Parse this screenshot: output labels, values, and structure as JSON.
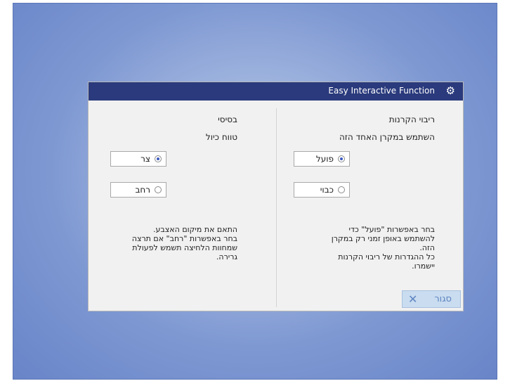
{
  "dialog": {
    "title": "Easy Interactive Function",
    "settings_icon": "gear-icon",
    "accent": "#2a3a7c"
  },
  "right_column": {
    "heading": "ריבוי הקרנות",
    "subheading": "השתמש במקרן האחד הזה",
    "options": [
      {
        "label": "פועל",
        "selected": true
      },
      {
        "label": "כבוי",
        "selected": false
      }
    ],
    "description": [
      "בחר באפשרות \"פועל\" כדי",
      "להשתמש באופן זמני רק במקרן",
      "הזה.",
      "כל ההגדרות של ריבוי הקרנות",
      "יישמרו."
    ]
  },
  "left_column": {
    "heading": "בסיסי",
    "subheading": "טווח כיול",
    "options": [
      {
        "label": "צר",
        "selected": true
      },
      {
        "label": "רחב",
        "selected": false
      }
    ],
    "description": [
      "התאם את מיקום האצבע.",
      "בחר באפשרות \"רחב\" אם תרצה",
      "שמחוות הלחיצה תשמש לפעולת",
      "גרירה."
    ]
  },
  "footer": {
    "close_label": "סגור",
    "close_icon": "close-icon"
  }
}
